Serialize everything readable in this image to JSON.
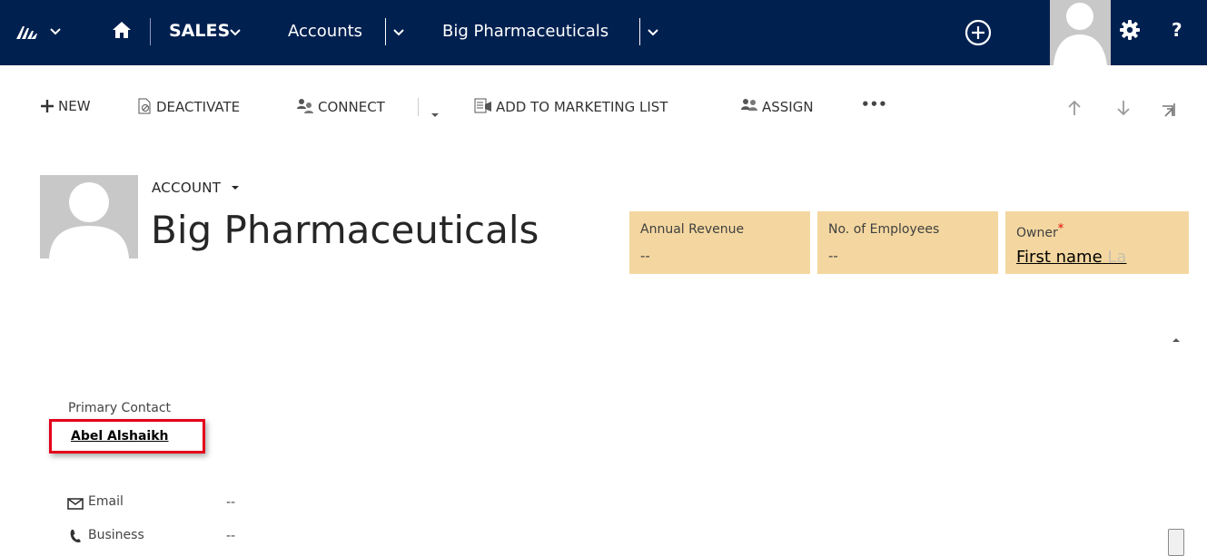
{
  "nav": {
    "module": "SALES",
    "entity": "Accounts",
    "record": "Big Pharmaceuticals"
  },
  "commands": {
    "new": "NEW",
    "deactivate": "DEACTIVATE",
    "connect": "CONNECT",
    "add_to_marketing_list": "ADD TO MARKETING LIST",
    "assign": "ASSIGN",
    "more": "•••"
  },
  "record": {
    "entity_label": "ACCOUNT",
    "title": "Big Pharmaceuticals"
  },
  "header_tiles": [
    {
      "label": "Annual Revenue",
      "value": "--"
    },
    {
      "label": "No. of Employees",
      "value": "--"
    },
    {
      "label": "Owner",
      "required_mark": "*",
      "value_visible": "First name",
      "value_faded": "La"
    }
  ],
  "primary_contact": {
    "label": "Primary Contact",
    "name": "Abel Alshaikh"
  },
  "fields": [
    {
      "label": "Email",
      "value": "--"
    },
    {
      "label": "Business",
      "value": "--"
    }
  ],
  "colors": {
    "nav_bg": "#002050",
    "tile_bg": "#f4d7a0",
    "highlight_border": "#e3001b"
  }
}
